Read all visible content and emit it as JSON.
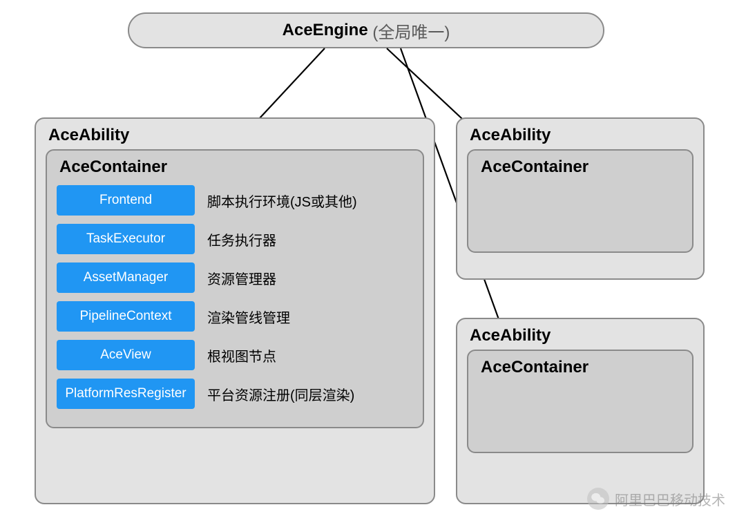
{
  "engine": {
    "title": "AceEngine",
    "note": "(全局唯一)"
  },
  "mainAbility": {
    "title": "AceAbility",
    "container": {
      "title": "AceContainer",
      "components": [
        {
          "name": "Frontend",
          "desc": "脚本执行环境(JS或其他)"
        },
        {
          "name": "TaskExecutor",
          "desc": "任务执行器"
        },
        {
          "name": "AssetManager",
          "desc": "资源管理器"
        },
        {
          "name": "PipelineContext",
          "desc": "渲染管线管理"
        },
        {
          "name": "AceView",
          "desc": "根视图节点"
        },
        {
          "name": "PlatformResRegister",
          "desc": "平台资源注册(同层渲染)"
        }
      ]
    }
  },
  "abilityTopRight": {
    "title": "AceAbility",
    "container": {
      "title": "AceContainer"
    }
  },
  "abilityBottomRight": {
    "title": "AceAbility",
    "container": {
      "title": "AceContainer"
    }
  },
  "watermark": {
    "text": "阿里巴巴移动技术"
  }
}
